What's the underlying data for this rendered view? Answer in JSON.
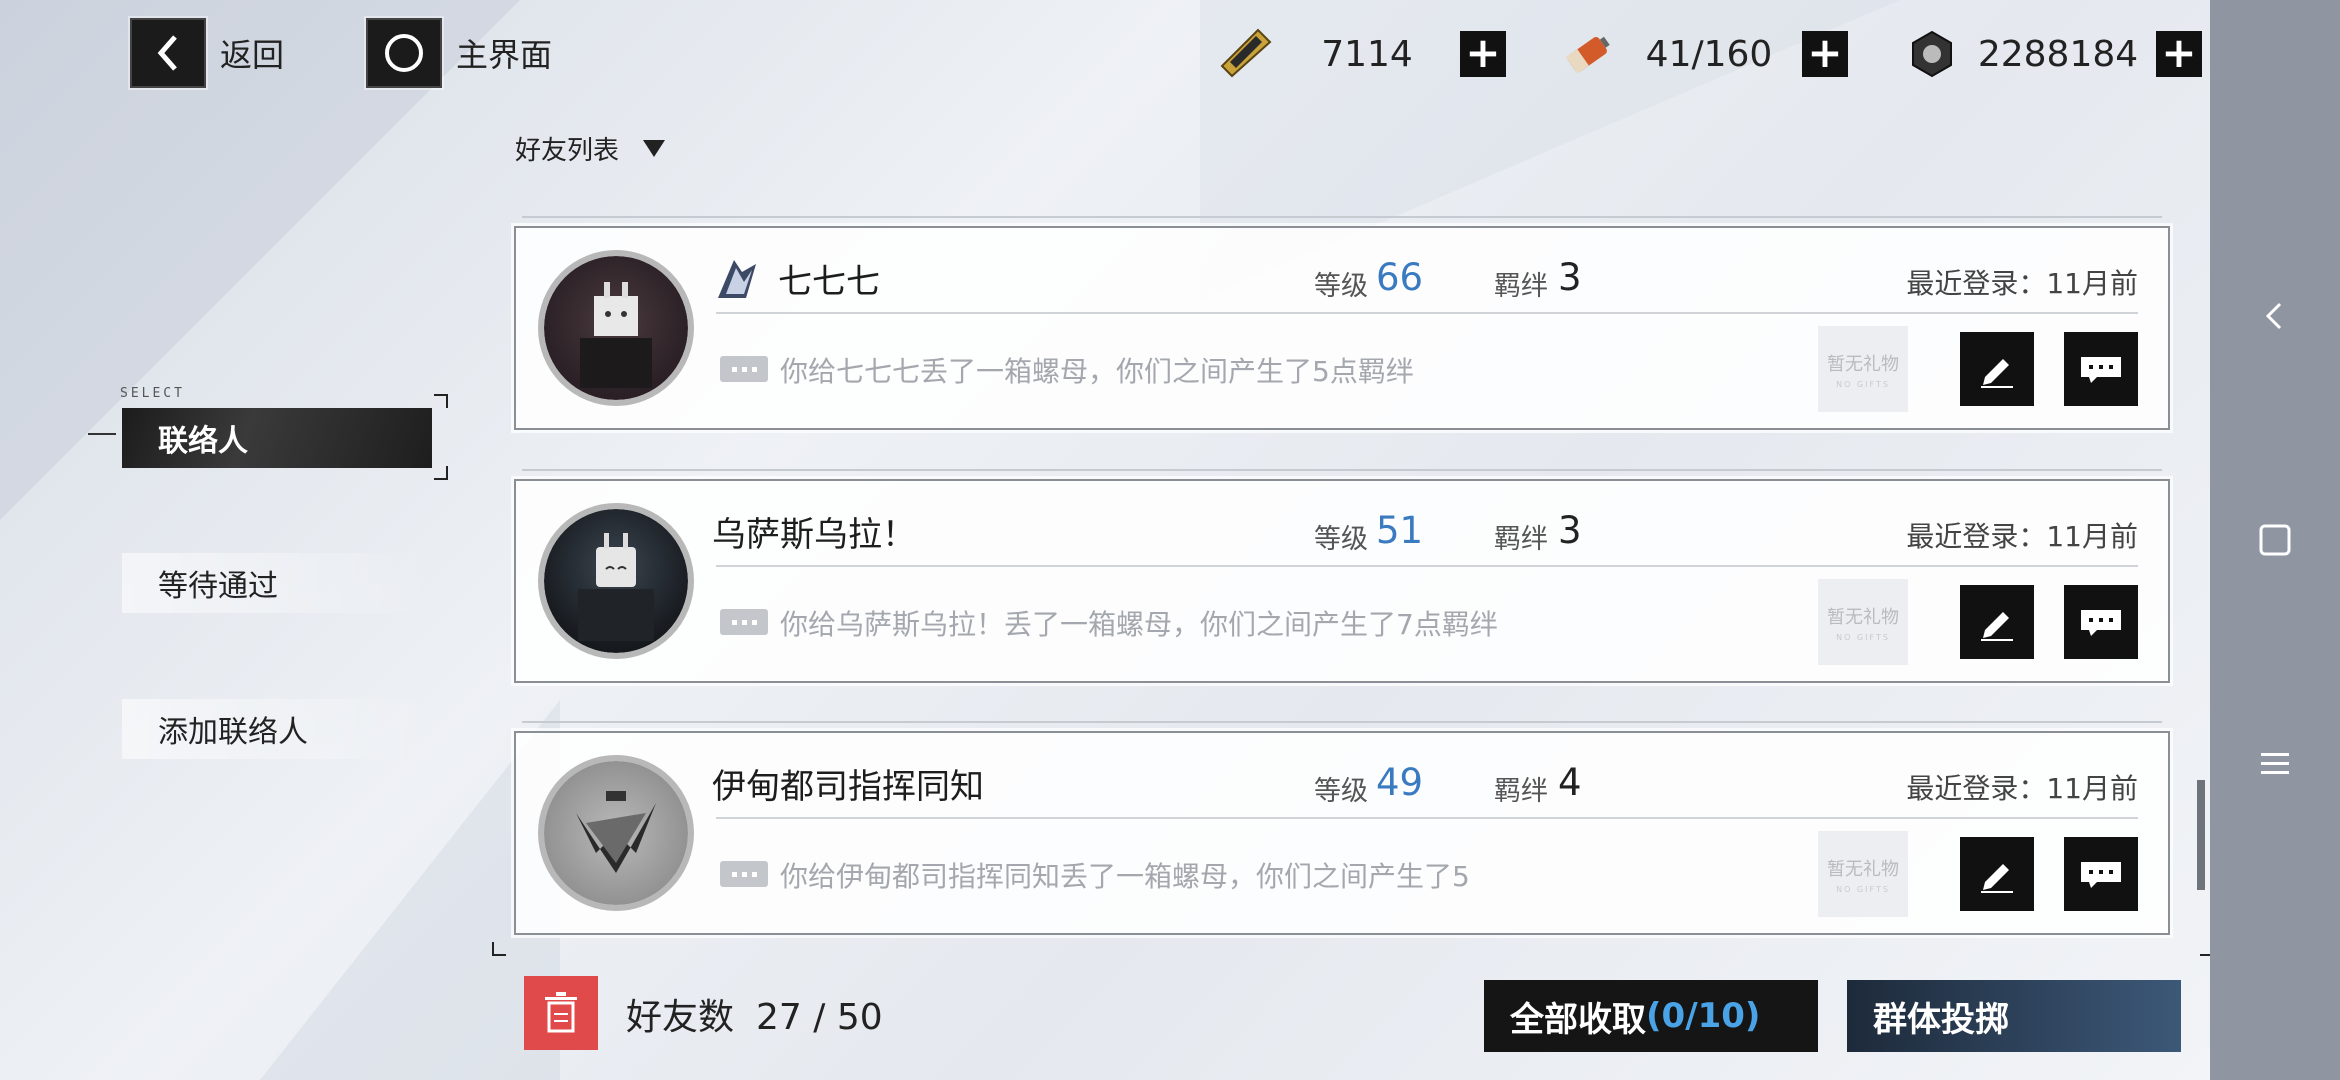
{
  "topbar": {
    "back_label": "返回",
    "home_label": "主界面",
    "resources": [
      {
        "icon": "ticket-icon",
        "value": "7114"
      },
      {
        "icon": "battery-icon",
        "value": "41/160"
      },
      {
        "icon": "nut-icon",
        "value": "2288184"
      }
    ]
  },
  "sidebar": {
    "select_tag": "SELECT",
    "items": [
      {
        "label": "联络人",
        "active": true
      },
      {
        "label": "等待通过",
        "active": false
      },
      {
        "label": "添加联络人",
        "active": false
      }
    ]
  },
  "list": {
    "header": "好友列表",
    "level_label": "等级",
    "bond_label": "羁绊",
    "gift_text": "暂无礼物",
    "gift_sub": "NO GIFTS",
    "friends": [
      {
        "name": "七七七",
        "level": "66",
        "bond": "3",
        "last_login": "最近登录：11月前",
        "message": "你给七七七丢了一箱螺母，你们之间产生了5点羁绊"
      },
      {
        "name": "乌萨斯乌拉！",
        "level": "51",
        "bond": "3",
        "last_login": "最近登录：11月前",
        "message": "你给乌萨斯乌拉！丢了一箱螺母，你们之间产生了7点羁绊"
      },
      {
        "name": "伊甸都司指挥同知",
        "level": "49",
        "bond": "4",
        "last_login": "最近登录：11月前",
        "message": "你给伊甸都司指挥同知丢了一箱螺母，你们之间产生了5"
      }
    ]
  },
  "footer": {
    "friend_label": "好友数",
    "friend_count": "27 / 50",
    "claim_label": "全部收取",
    "claim_count": "(0/10)",
    "throw_label": "群体投掷"
  },
  "colors": {
    "accent_blue": "#3a7ac0",
    "claim_count": "#4aa3e6",
    "delete_red": "#e04a4a"
  }
}
